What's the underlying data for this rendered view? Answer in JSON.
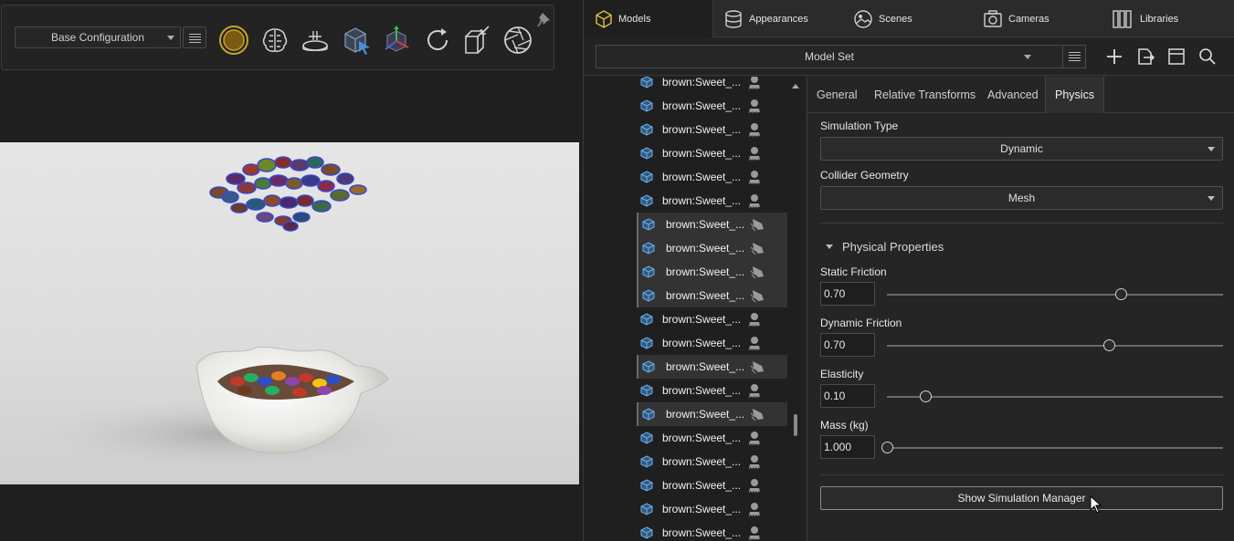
{
  "toolbar": {
    "configuration": "Base Configuration",
    "tools": [
      "sun-icon",
      "brain-icon",
      "turntable-icon",
      "select-cube-icon",
      "transform-gizmo-icon",
      "refresh-icon",
      "box-import-icon",
      "aperture-icon",
      "pin-icon"
    ]
  },
  "tabs": [
    {
      "label": "Models",
      "icon": "cube-icon"
    },
    {
      "label": "Appearances",
      "icon": "sphere-stack-icon"
    },
    {
      "label": "Scenes",
      "icon": "image-icon"
    },
    {
      "label": "Cameras",
      "icon": "camera-icon"
    },
    {
      "label": "Libraries",
      "icon": "books-icon"
    }
  ],
  "modelset": {
    "label": "Model Set",
    "actions": [
      "add-icon",
      "export-icon",
      "layout-icon",
      "search-icon"
    ]
  },
  "tree": {
    "rows": [
      {
        "label": "brown:Sweet_...",
        "selected": false
      },
      {
        "label": "brown:Sweet_...",
        "selected": false
      },
      {
        "label": "brown:Sweet_...",
        "selected": false
      },
      {
        "label": "brown:Sweet_...",
        "selected": false
      },
      {
        "label": "brown:Sweet_...",
        "selected": false
      },
      {
        "label": "brown:Sweet_...",
        "selected": false
      },
      {
        "label": "brown:Sweet_...",
        "selected": true
      },
      {
        "label": "brown:Sweet_...",
        "selected": true
      },
      {
        "label": "brown:Sweet_...",
        "selected": true
      },
      {
        "label": "brown:Sweet_...",
        "selected": true
      },
      {
        "label": "brown:Sweet_...",
        "selected": false
      },
      {
        "label": "brown:Sweet_...",
        "selected": false
      },
      {
        "label": "brown:Sweet_...",
        "selected": true
      },
      {
        "label": "brown:Sweet_...",
        "selected": false
      },
      {
        "label": "brown:Sweet_...",
        "selected": true
      },
      {
        "label": "brown:Sweet_...",
        "selected": false
      },
      {
        "label": "brown:Sweet_...",
        "selected": false
      },
      {
        "label": "brown:Sweet_...",
        "selected": false
      },
      {
        "label": "brown:Sweet_...",
        "selected": false
      },
      {
        "label": "brown:Sweet_...",
        "selected": false
      }
    ]
  },
  "props": {
    "tabs": [
      "General",
      "Relative Transforms",
      "Advanced",
      "Physics"
    ],
    "active_tab": "Physics",
    "simulation_type_label": "Simulation Type",
    "simulation_type": "Dynamic",
    "collider_label": "Collider Geometry",
    "collider": "Mesh",
    "section_title": "Physical Properties",
    "static_friction_label": "Static Friction",
    "static_friction": "0.70",
    "static_friction_fraction": 0.695,
    "dynamic_friction_label": "Dynamic Friction",
    "dynamic_friction": "0.70",
    "dynamic_friction_fraction": 0.661,
    "elasticity_label": "Elasticity",
    "elasticity": "0.10",
    "elasticity_fraction": 0.114,
    "mass_label": "Mass (kg)",
    "mass": "1.000",
    "mass_fraction": 0.0,
    "sim_manager_button": "Show Simulation Manager"
  },
  "colors": {
    "accent_gold": "#c9a227",
    "cube_blue": "#5aa0d8",
    "panel_bg": "#252526"
  }
}
